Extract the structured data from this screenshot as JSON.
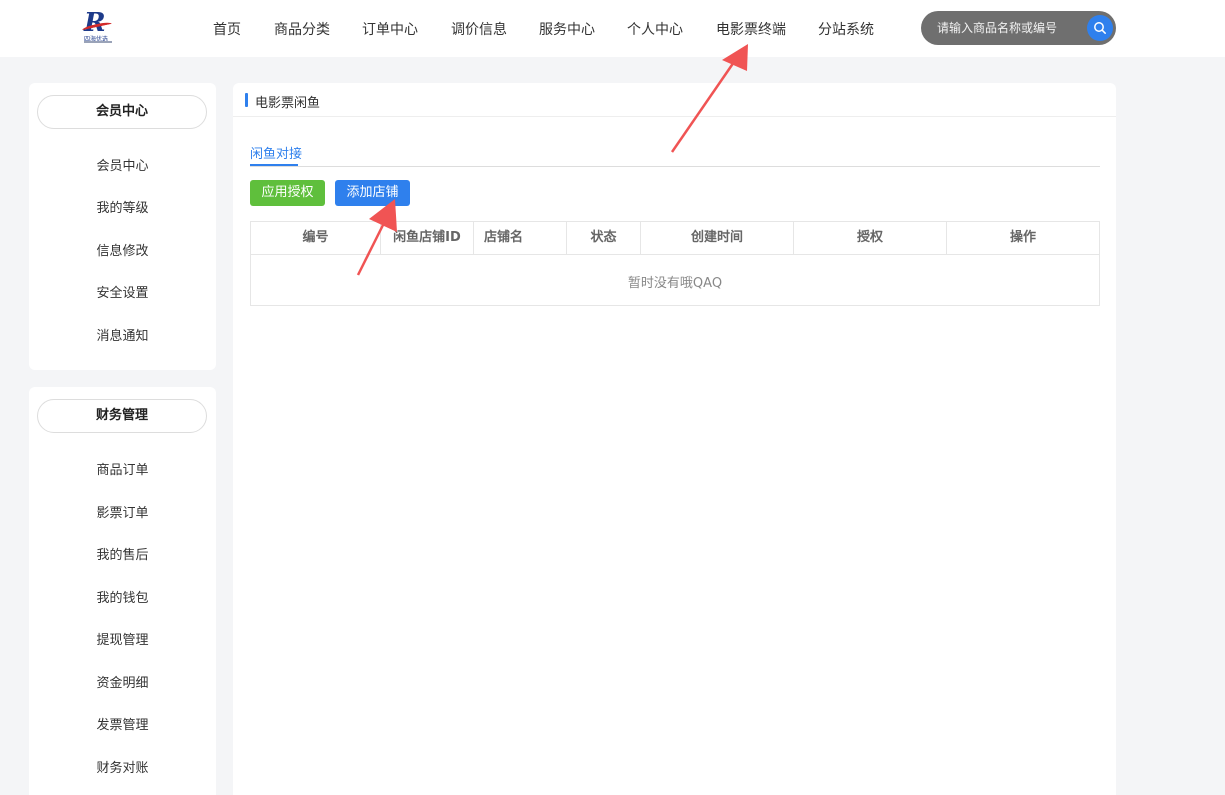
{
  "logo": {
    "text": "四海优选"
  },
  "nav": {
    "items": [
      "首页",
      "商品分类",
      "订单中心",
      "调价信息",
      "服务中心",
      "个人中心",
      "电影票终端",
      "分站系统"
    ]
  },
  "search": {
    "placeholder": "请输入商品名称或编号"
  },
  "sidebar": {
    "member": {
      "title": "会员中心",
      "items": [
        "会员中心",
        "我的等级",
        "信息修改",
        "安全设置",
        "消息通知"
      ]
    },
    "finance": {
      "title": "财务管理",
      "items": [
        "商品订单",
        "影票订单",
        "我的售后",
        "我的钱包",
        "提现管理",
        "资金明细",
        "发票管理",
        "财务对账"
      ]
    }
  },
  "main": {
    "title": "电影票闲鱼",
    "tab": "闲鱼对接",
    "buttons": {
      "apply_auth": "应用授权",
      "add_store": "添加店铺"
    },
    "table": {
      "columns": [
        "编号",
        "闲鱼店铺ID",
        "店铺名",
        "状态",
        "创建时间",
        "授权",
        "操作"
      ],
      "empty_text": "暂时没有哦QAQ"
    }
  },
  "colors": {
    "accent": "#2f80ed",
    "green": "#5fbf3c",
    "arrow": "#f05454"
  }
}
